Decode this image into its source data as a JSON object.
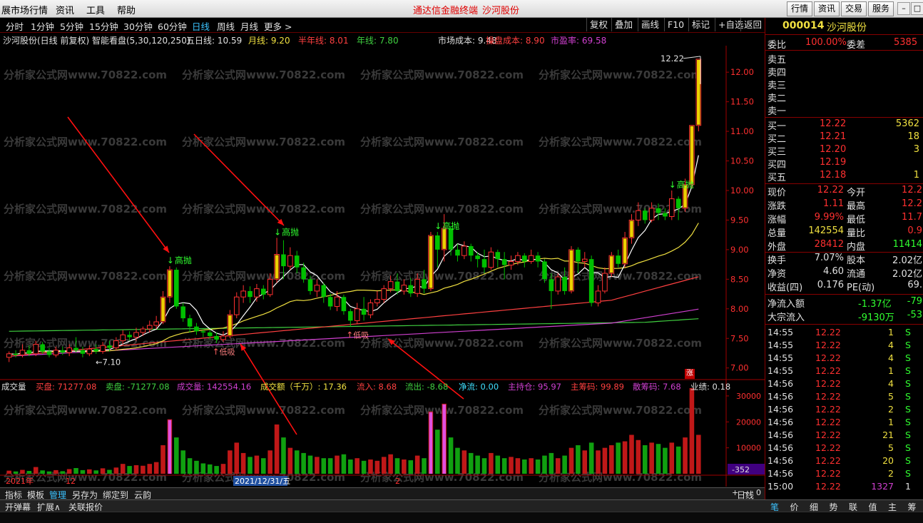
{
  "menubar": {
    "items": [
      "展市场行情",
      "资讯",
      "工具",
      "帮助"
    ],
    "center_title": "通达信金融终端",
    "center_stock": "沙河股份",
    "right_buttons": [
      "行情",
      "资讯",
      "交易",
      "服务"
    ]
  },
  "periods": [
    "分时",
    "1分钟",
    "5分钟",
    "15分钟",
    "30分钟",
    "60分钟",
    "日线",
    "周线",
    "月线",
    "更多 >"
  ],
  "active_period": "日线",
  "toolbar": [
    "复权",
    "叠加",
    "画线",
    "F10",
    "标记",
    "+自选",
    "返回"
  ],
  "info": {
    "name": "沙河股份(日线 前复权) 智能看盘(5,30,120,250)",
    "ma5": "五日线: 10.59",
    "ma_month": "月线: 9.20",
    "ma_half": "半年线: 8.01",
    "ma_year": "年线: 7.80",
    "market_cost": "市场成本: 9.48",
    "op_cost": "操盘成本: 8.90",
    "pe": "市盈率: 69.58"
  },
  "chart_data": {
    "type": "candlestick",
    "price_axis": {
      "ticks": [
        "12.00",
        "11.50",
        "11.00",
        "10.50",
        "10.00",
        "9.50",
        "9.00",
        "8.50",
        "8.00",
        "7.50",
        "7.00"
      ],
      "ylim": [
        6.9,
        12.4
      ]
    },
    "annotations": {
      "high_label": "12.22",
      "low_label": "7.10",
      "sell_label": "高抛",
      "buy_label": "低吸"
    },
    "candles": [
      [
        7.18,
        7.24,
        7.1,
        7.28
      ],
      [
        7.24,
        7.22,
        7.18,
        7.3
      ],
      [
        7.22,
        7.3,
        7.18,
        7.4
      ],
      [
        7.3,
        7.24,
        7.2,
        7.38
      ],
      [
        7.24,
        7.4,
        7.2,
        7.46
      ],
      [
        7.4,
        7.28,
        7.24,
        7.44
      ],
      [
        7.28,
        7.22,
        7.18,
        7.34
      ],
      [
        7.22,
        7.3,
        7.18,
        7.36
      ],
      [
        7.3,
        7.26,
        7.22,
        7.36
      ],
      [
        7.26,
        7.34,
        7.2,
        7.4
      ],
      [
        7.34,
        7.3,
        7.26,
        7.52
      ],
      [
        7.3,
        7.24,
        7.18,
        7.36
      ],
      [
        7.24,
        7.32,
        7.2,
        7.38
      ],
      [
        7.32,
        7.28,
        7.24,
        7.4
      ],
      [
        7.28,
        7.38,
        7.24,
        7.44
      ],
      [
        7.38,
        7.34,
        7.28,
        7.46
      ],
      [
        7.34,
        7.46,
        7.3,
        7.52
      ],
      [
        7.46,
        7.56,
        7.4,
        7.64
      ],
      [
        7.56,
        7.52,
        7.46,
        7.62
      ],
      [
        7.52,
        7.6,
        7.46,
        7.68
      ],
      [
        7.6,
        7.66,
        7.54,
        7.7
      ],
      [
        7.66,
        7.72,
        7.6,
        7.8
      ],
      [
        7.72,
        7.78,
        7.66,
        7.88
      ],
      [
        7.78,
        8.2,
        7.74,
        8.3
      ],
      [
        8.2,
        8.66,
        8.1,
        8.72
      ],
      [
        8.66,
        8.04,
        8.0,
        8.7
      ],
      [
        8.04,
        7.84,
        7.78,
        8.1
      ],
      [
        7.84,
        7.7,
        7.6,
        7.9
      ],
      [
        7.7,
        7.62,
        7.56,
        7.76
      ],
      [
        7.62,
        7.6,
        7.52,
        7.66
      ],
      [
        7.6,
        7.54,
        7.48,
        7.64
      ],
      [
        7.54,
        7.48,
        7.42,
        7.6
      ],
      [
        7.48,
        7.54,
        7.44,
        7.62
      ],
      [
        7.54,
        7.9,
        7.5,
        7.98
      ],
      [
        7.9,
        8.2,
        7.84,
        8.28
      ],
      [
        8.2,
        8.3,
        8.1,
        8.4
      ],
      [
        8.3,
        8.2,
        8.1,
        8.38
      ],
      [
        8.2,
        8.34,
        8.12,
        8.42
      ],
      [
        8.34,
        8.24,
        8.16,
        8.4
      ],
      [
        8.24,
        8.5,
        8.2,
        8.6
      ],
      [
        8.5,
        8.92,
        8.44,
        9.2
      ],
      [
        8.92,
        8.72,
        8.5,
        9.16
      ],
      [
        8.72,
        8.9,
        8.66,
        9.04
      ],
      [
        8.9,
        8.7,
        8.6,
        8.98
      ],
      [
        8.7,
        8.5,
        8.44,
        8.78
      ],
      [
        8.5,
        8.3,
        8.24,
        8.56
      ],
      [
        8.3,
        8.4,
        8.2,
        8.5
      ],
      [
        8.4,
        8.2,
        8.1,
        8.44
      ],
      [
        8.2,
        8.04,
        7.98,
        8.26
      ],
      [
        8.04,
        8.2,
        7.96,
        8.3
      ],
      [
        8.2,
        7.96,
        7.9,
        8.24
      ],
      [
        7.96,
        7.8,
        7.7,
        8.0
      ],
      [
        7.8,
        8.0,
        7.74,
        8.1
      ],
      [
        8.0,
        7.9,
        7.8,
        8.2
      ],
      [
        7.9,
        8.1,
        7.84,
        8.16
      ],
      [
        8.1,
        8.16,
        8.04,
        8.3
      ],
      [
        8.16,
        8.34,
        8.1,
        8.4
      ],
      [
        8.34,
        8.46,
        8.28,
        8.56
      ],
      [
        8.46,
        8.3,
        8.24,
        8.6
      ],
      [
        8.3,
        8.4,
        8.24,
        8.5
      ],
      [
        8.4,
        8.26,
        8.2,
        8.52
      ],
      [
        8.26,
        8.5,
        8.2,
        8.6
      ],
      [
        8.5,
        8.34,
        8.26,
        8.66
      ],
      [
        8.34,
        9.24,
        8.3,
        9.3
      ],
      [
        9.24,
        9.0,
        8.7,
        9.3
      ],
      [
        9.0,
        9.36,
        8.8,
        9.6
      ],
      [
        9.36,
        9.0,
        8.9,
        9.4
      ],
      [
        9.0,
        8.9,
        8.8,
        9.1
      ],
      [
        8.9,
        9.06,
        8.84,
        9.14
      ],
      [
        9.06,
        8.9,
        8.8,
        9.1
      ],
      [
        8.9,
        8.84,
        8.7,
        8.96
      ],
      [
        8.84,
        8.7,
        8.6,
        9.0
      ],
      [
        8.7,
        8.96,
        8.66,
        9.04
      ],
      [
        8.96,
        8.84,
        8.7,
        9.0
      ],
      [
        8.84,
        8.74,
        8.5,
        8.96
      ],
      [
        8.74,
        8.8,
        8.66,
        8.9
      ],
      [
        8.8,
        8.9,
        8.74,
        8.96
      ],
      [
        8.9,
        8.8,
        8.7,
        8.94
      ],
      [
        8.8,
        8.9,
        8.76,
        9.0
      ],
      [
        8.9,
        8.8,
        8.7,
        8.96
      ],
      [
        8.8,
        8.5,
        8.44,
        8.84
      ],
      [
        8.5,
        8.3,
        8.0,
        8.6
      ],
      [
        8.3,
        8.54,
        8.24,
        8.6
      ],
      [
        8.54,
        8.3,
        8.24,
        8.7
      ],
      [
        8.3,
        9.0,
        8.26,
        9.06
      ],
      [
        9.0,
        8.8,
        8.6,
        9.04
      ],
      [
        8.8,
        8.84,
        8.7,
        8.96
      ],
      [
        8.84,
        8.1,
        8.04,
        8.9
      ],
      [
        8.1,
        8.3,
        8.04,
        8.4
      ],
      [
        8.3,
        8.6,
        8.26,
        8.7
      ],
      [
        8.6,
        8.9,
        8.54,
        8.96
      ],
      [
        8.9,
        8.76,
        8.7,
        9.0
      ],
      [
        8.76,
        9.2,
        8.7,
        9.3
      ],
      [
        9.2,
        9.5,
        9.1,
        9.6
      ],
      [
        9.5,
        9.66,
        9.4,
        9.8
      ],
      [
        9.66,
        9.5,
        9.44,
        9.7
      ],
      [
        9.5,
        9.7,
        9.46,
        9.8
      ],
      [
        9.7,
        9.62,
        9.5,
        9.78
      ],
      [
        9.62,
        9.56,
        9.5,
        9.7
      ],
      [
        9.56,
        9.86,
        9.5,
        10.0
      ],
      [
        9.86,
        9.7,
        9.5,
        9.9
      ],
      [
        9.7,
        10.1,
        9.64,
        10.2
      ],
      [
        10.1,
        11.1,
        10.04,
        11.1
      ],
      [
        11.1,
        12.22,
        11.0,
        12.22
      ]
    ],
    "volume_axis": {
      "ticks": [
        "30000",
        "20000",
        "10000"
      ],
      "ylim": [
        0,
        33000
      ]
    },
    "volume_readout": "-352",
    "x_labels": [
      "2021年",
      "12",
      "2021/12/31/五",
      "2"
    ]
  },
  "indicator": {
    "name": "成交量",
    "buy": "买盘: 71277.08",
    "sell": "卖盘: -71277.08",
    "vol": "成交量: 142554.16",
    "amount": "成交额（千万）: 17.36",
    "inflow": "流入: 8.68",
    "outflow": "流出: -8.68",
    "net": "净流: 0.00",
    "main": "主持仓: 95.97",
    "chip": "主筹码: 99.89",
    "retail": "散筹码: 7.68",
    "perf": "业绩: 0.18",
    "badge": "涨"
  },
  "quote": {
    "code": "000014",
    "name": "沙河股份",
    "weibi_label": "委比",
    "weibi": "100.00%",
    "weicha_label": "委差",
    "weicha": "5385",
    "sells": [
      {
        "label": "卖五"
      },
      {
        "label": "卖四"
      },
      {
        "label": "卖三"
      },
      {
        "label": "卖二"
      },
      {
        "label": "卖一"
      }
    ],
    "buys": [
      {
        "label": "买一",
        "price": "12.22",
        "vol": "5362"
      },
      {
        "label": "买二",
        "price": "12.21",
        "vol": "18"
      },
      {
        "label": "买三",
        "price": "12.20",
        "vol": "3"
      },
      {
        "label": "买四",
        "price": "12.19",
        "vol": ""
      },
      {
        "label": "买五",
        "price": "12.18",
        "vol": "1"
      }
    ],
    "stats": [
      {
        "l1": "现价",
        "v1": "12.22",
        "l2": "今开",
        "v2": "12.2"
      },
      {
        "l1": "涨跌",
        "v1": "1.11",
        "l2": "最高",
        "v2": "12.2"
      },
      {
        "l1": "涨幅",
        "v1": "9.99%",
        "l2": "最低",
        "v2": "11.7"
      },
      {
        "l1": "总量",
        "v1": "142554",
        "l2": "量比",
        "v2": "0.9"
      },
      {
        "l1": "外盘",
        "v1": "28412",
        "l2": "内盘",
        "v2": "11414"
      },
      {
        "l1": "换手",
        "v1": "7.07%",
        "l2": "股本",
        "v2": "2.02亿"
      },
      {
        "l1": "净资",
        "v1": "4.60",
        "l2": "流通",
        "v2": "2.02亿"
      },
      {
        "l1": "收益(四)",
        "v1": "0.176",
        "l2": "PE(动)",
        "v2": "69."
      }
    ],
    "flow": [
      {
        "label": "净流入额",
        "v1": "-1.37亿",
        "v2": "-79"
      },
      {
        "label": "大宗流入",
        "v1": "-9130万",
        "v2": "-53"
      }
    ],
    "ticks": [
      {
        "t": "14:55",
        "p": "12.22",
        "v": "1",
        "s": "S"
      },
      {
        "t": "14:55",
        "p": "12.22",
        "v": "4",
        "s": "S"
      },
      {
        "t": "14:55",
        "p": "12.22",
        "v": "4",
        "s": "S"
      },
      {
        "t": "14:55",
        "p": "12.22",
        "v": "1",
        "s": "S"
      },
      {
        "t": "14:56",
        "p": "12.22",
        "v": "4",
        "s": "S"
      },
      {
        "t": "14:56",
        "p": "12.22",
        "v": "5",
        "s": "S"
      },
      {
        "t": "14:56",
        "p": "12.22",
        "v": "2",
        "s": "S"
      },
      {
        "t": "14:56",
        "p": "12.22",
        "v": "1",
        "s": "S"
      },
      {
        "t": "14:56",
        "p": "12.22",
        "v": "21",
        "s": "S"
      },
      {
        "t": "14:56",
        "p": "12.22",
        "v": "5",
        "s": "S"
      },
      {
        "t": "14:56",
        "p": "12.22",
        "v": "20",
        "s": "S"
      },
      {
        "t": "14:56",
        "p": "12.22",
        "v": "2",
        "s": "S"
      },
      {
        "t": "15:00",
        "p": "12.22",
        "v": "1327",
        "s": "1"
      }
    ]
  },
  "bottom1": [
    "指标",
    "模板",
    "管理",
    "另存为",
    "绑定到",
    "云韵"
  ],
  "bottom1_right": "日线",
  "bottom1_ctrl": [
    "+",
    "−",
    "0"
  ],
  "bottom2": [
    "开弹幕",
    "扩展∧",
    "关联报价"
  ],
  "right_tabs": [
    "笔",
    "价",
    "细",
    "势",
    "联",
    "值",
    "主",
    "筹"
  ],
  "watermark": "分析家公式网www.70822.com",
  "colors": {
    "up": "#ff3030",
    "down": "#00c000",
    "ma5": "#ffffff",
    "ma_month": "#f0e040",
    "ma_half": "#ff4040",
    "ma_year": "#40d040",
    "purple": "#d040d0",
    "cyan": "#40e0ff"
  }
}
